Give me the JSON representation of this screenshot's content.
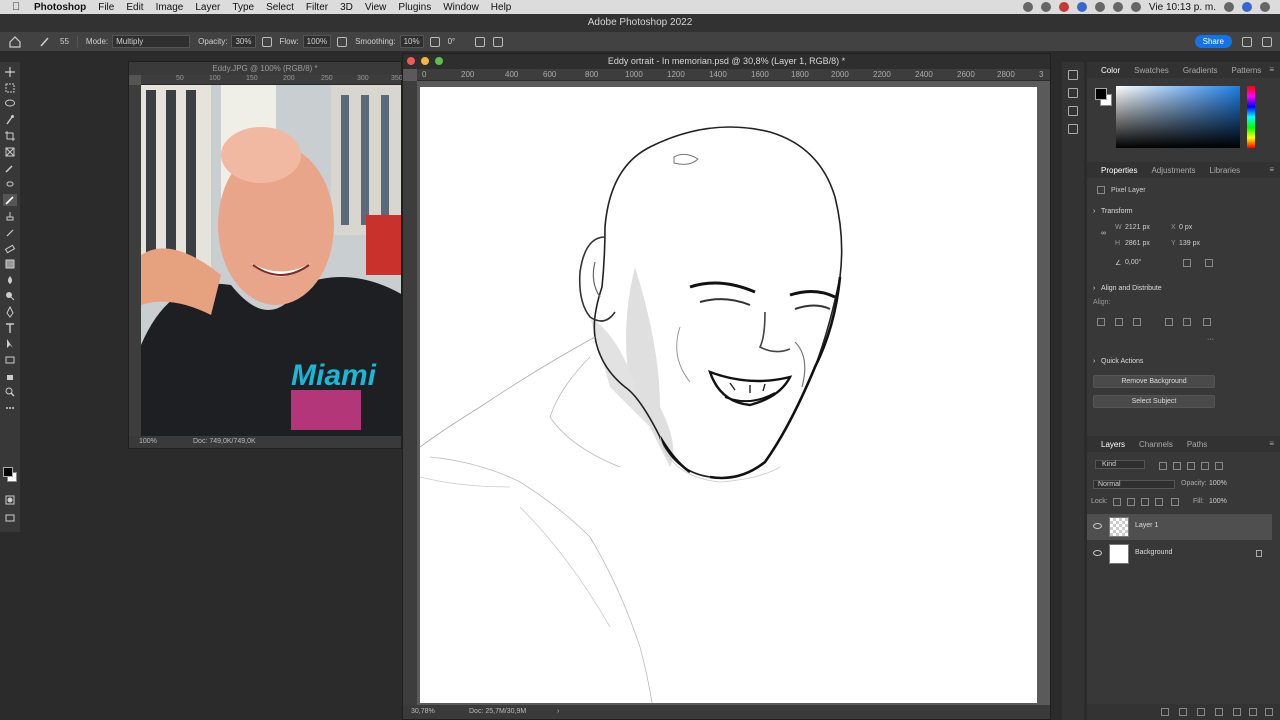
{
  "menubar": {
    "app_name": "Photoshop",
    "items": [
      "File",
      "Edit",
      "Image",
      "Layer",
      "Type",
      "Select",
      "Filter",
      "3D",
      "View",
      "Plugins",
      "Window",
      "Help"
    ],
    "clock": "Vie 10:13 p. m."
  },
  "app": {
    "title": "Adobe Photoshop 2022"
  },
  "options": {
    "brush_size": "55",
    "mode_label": "Mode:",
    "mode_value": "Multiply",
    "opacity_label": "Opacity:",
    "opacity_value": "30%",
    "flow_label": "Flow:",
    "flow_value": "100%",
    "smoothing_label": "Smoothing:",
    "smoothing_value": "10%",
    "angle_value": "0°",
    "share_label": "Share"
  },
  "photo_window": {
    "title": "Eddy.JPG @ 100% (RGB/8) *",
    "zoom": "100%",
    "doc_info": "Doc: 749,0K/749,0K",
    "ruler_labels": [
      "50",
      "100",
      "150",
      "200",
      "250",
      "300",
      "350"
    ]
  },
  "doc_window": {
    "title": "Eddy ortrait - In memorian.psd @ 30,8% (Layer 1, RGB/8) *",
    "zoom": "30,78%",
    "doc_info": "Doc: 25,7M/30,9M",
    "ruler_labels": [
      "0",
      "200",
      "400",
      "600",
      "800",
      "1000",
      "1200",
      "1400",
      "1600",
      "1800",
      "2000",
      "2200",
      "2400",
      "2600",
      "2800",
      "3"
    ]
  },
  "color_panel": {
    "tabs": [
      "Color",
      "Swatches",
      "Gradients",
      "Patterns"
    ],
    "accent_hue": "#1e7fe6"
  },
  "properties_panel": {
    "tabs": [
      "Properties",
      "Adjustments",
      "Libraries"
    ],
    "layer_type": "Pixel Layer",
    "transform_title": "Transform",
    "w_label": "W",
    "w_value": "2121 px",
    "h_label": "H",
    "h_value": "2861 px",
    "x_label": "X",
    "x_value": "0 px",
    "y_label": "Y",
    "y_value": "139 px",
    "angle_value": "0,00°",
    "align_title": "Align and Distribute",
    "align_label": "Align:",
    "quick_actions_title": "Quick Actions",
    "remove_bg_label": "Remove Background",
    "select_subject_label": "Select Subject"
  },
  "layers_panel": {
    "tabs": [
      "Layers",
      "Channels",
      "Paths"
    ],
    "filter_label": "Kind",
    "blend_mode": "Normal",
    "opacity_label": "Opacity:",
    "opacity_value": "100%",
    "lock_label": "Lock:",
    "fill_label": "Fill:",
    "fill_value": "100%",
    "layers": [
      {
        "name": "Layer 1",
        "selected": true
      },
      {
        "name": "Background",
        "selected": false
      }
    ]
  }
}
